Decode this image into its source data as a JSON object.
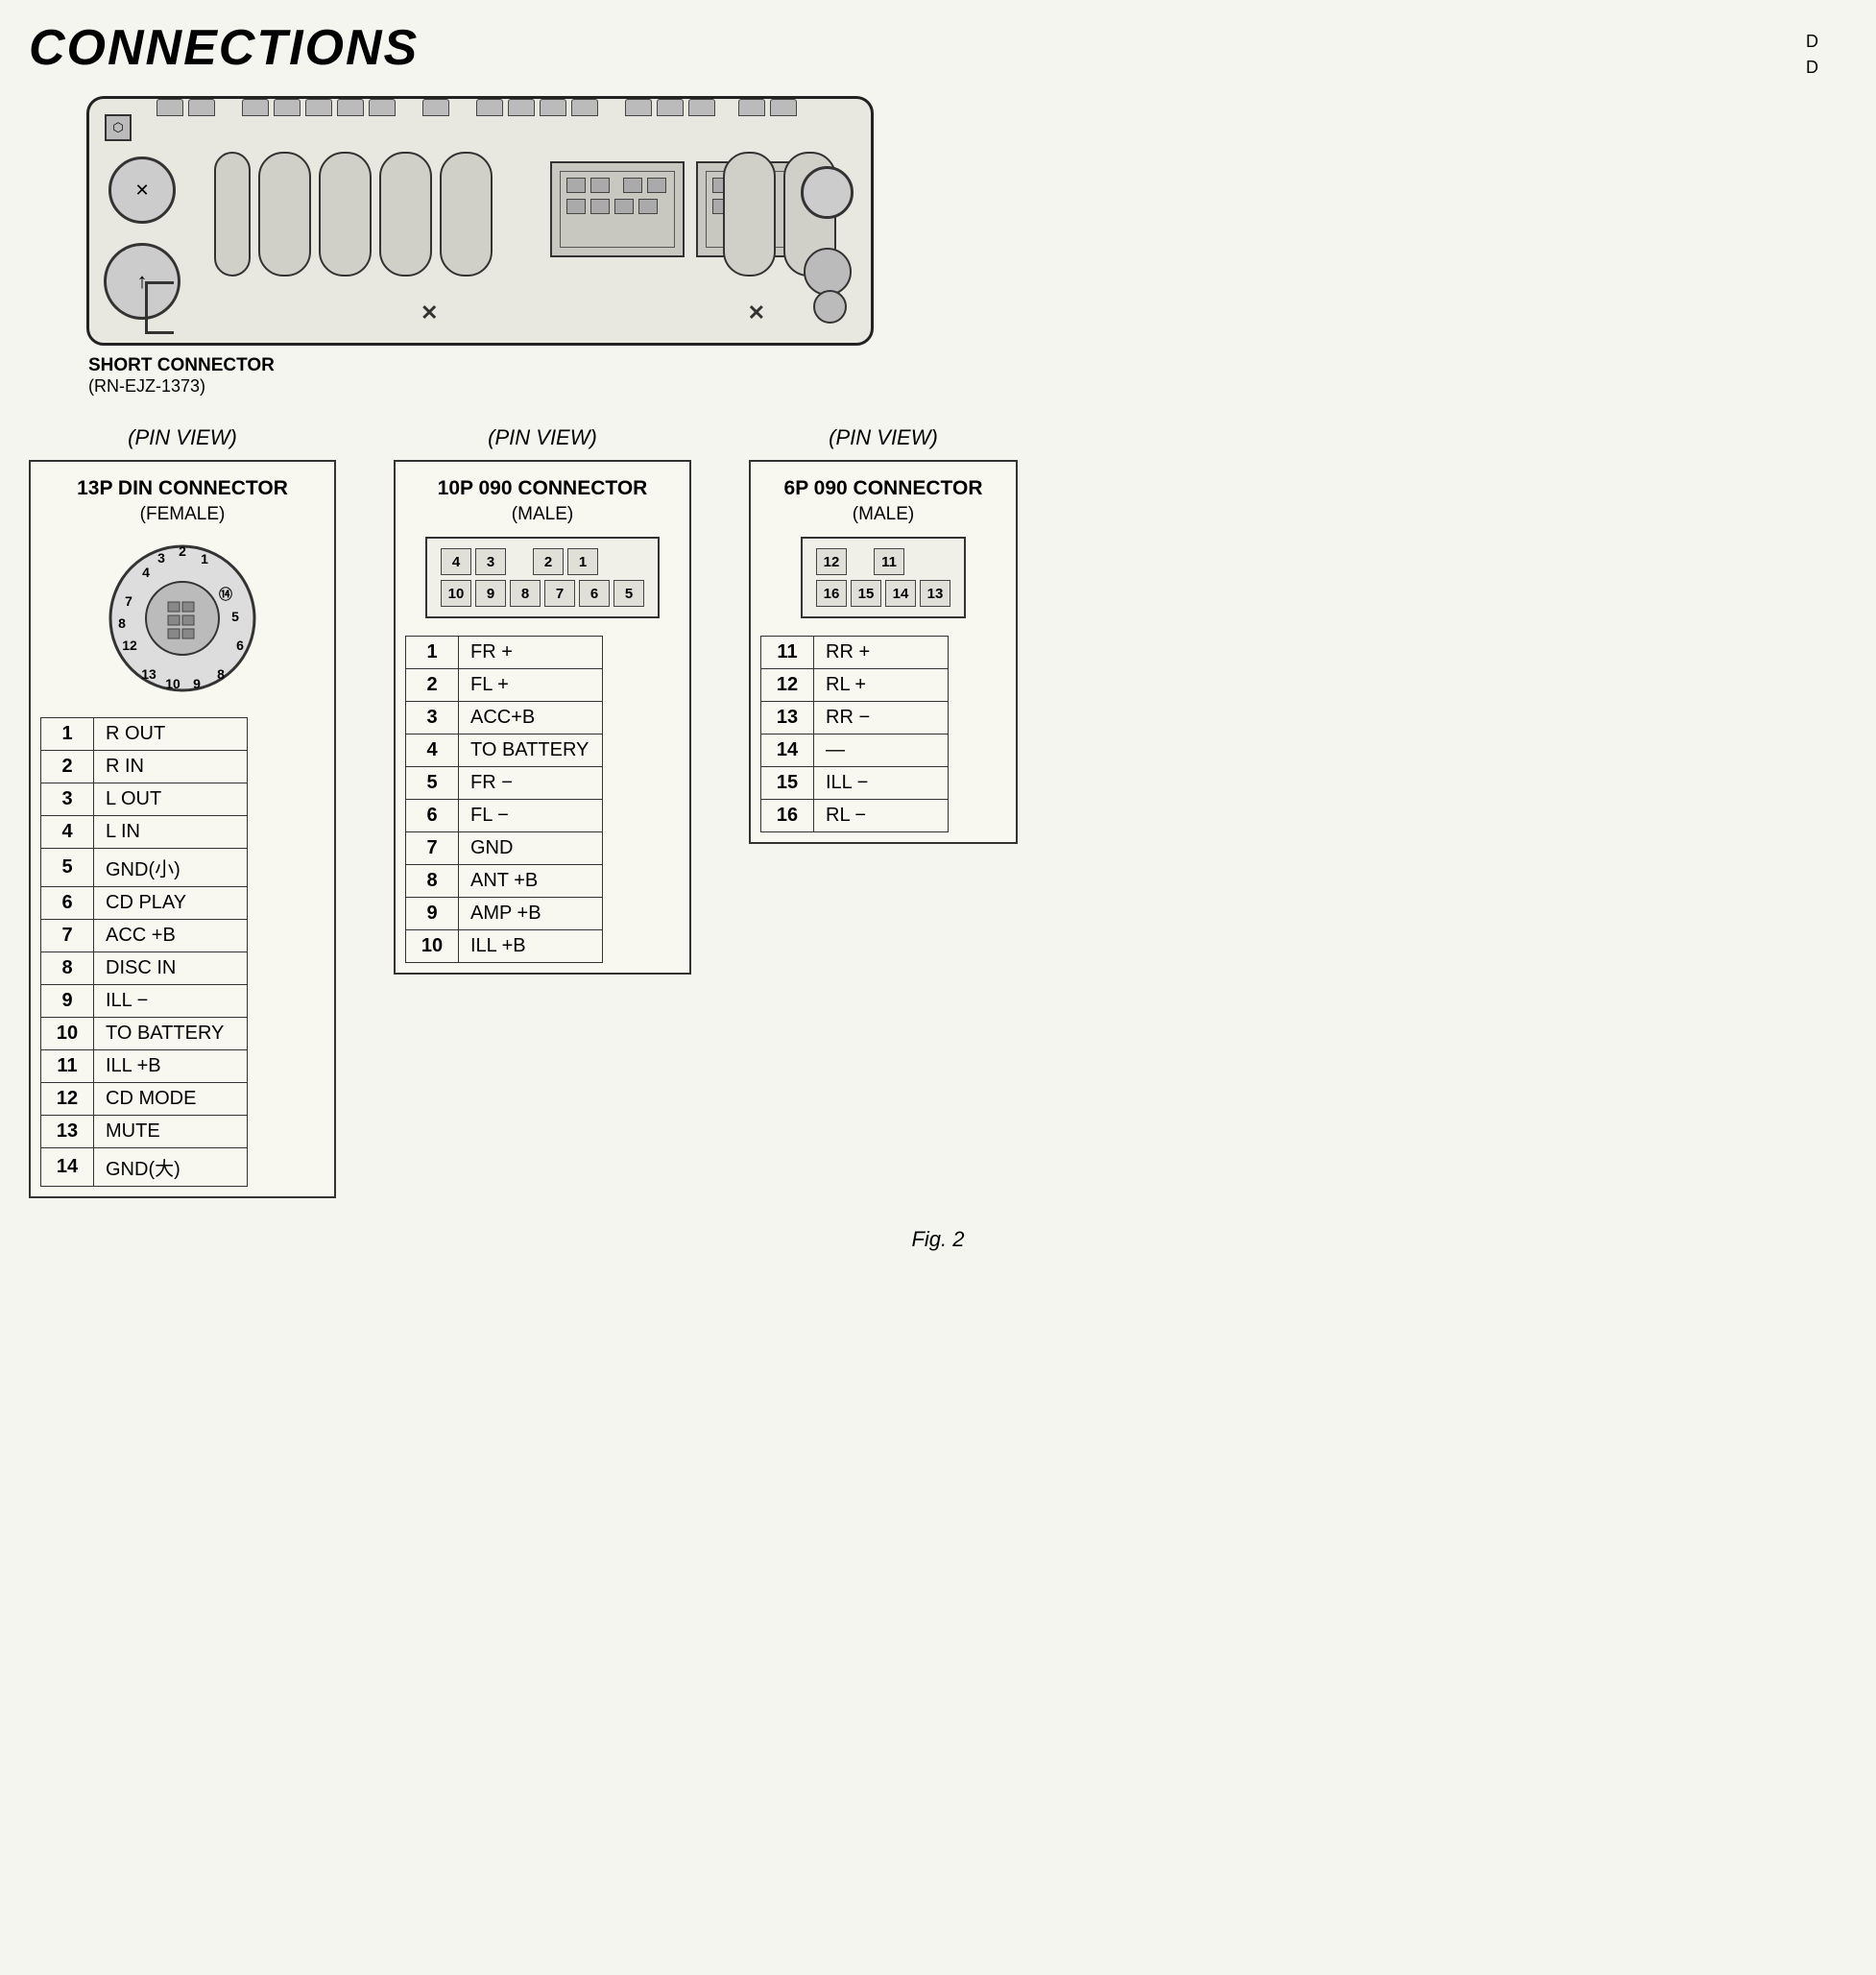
{
  "page": {
    "title": "CONNECTIONS",
    "corner_note": "D\nD",
    "short_connector_label": "SHORT CONNECTOR",
    "short_connector_code": "(RN-EJZ-1373)",
    "fig_label": "Fig. 2"
  },
  "pin_view_13p": {
    "view_label": "(PIN  VIEW)",
    "connector_title": "13P DIN CONNECTOR",
    "connector_subtitle": "(FEMALE)",
    "pins": [
      {
        "num": "1",
        "name": "R OUT"
      },
      {
        "num": "2",
        "name": "R IN"
      },
      {
        "num": "3",
        "name": "L OUT"
      },
      {
        "num": "4",
        "name": "L IN"
      },
      {
        "num": "5",
        "name": "GND(小)"
      },
      {
        "num": "6",
        "name": "CD PLAY"
      },
      {
        "num": "7",
        "name": "ACC +B"
      },
      {
        "num": "8",
        "name": "DISC IN"
      },
      {
        "num": "9",
        "name": "ILL −"
      },
      {
        "num": "10",
        "name": "TO BATTERY"
      },
      {
        "num": "11",
        "name": "ILL +B"
      },
      {
        "num": "12",
        "name": "CD MODE"
      },
      {
        "num": "13",
        "name": "MUTE"
      },
      {
        "num": "14",
        "name": "GND(大)"
      }
    ]
  },
  "pin_view_10p": {
    "view_label": "(PIN  VIEW)",
    "connector_title": "10P 090 CONNECTOR",
    "connector_subtitle": "(MALE)",
    "diagram_row1": [
      "4",
      "3",
      "",
      "2",
      "1"
    ],
    "diagram_row2": [
      "10",
      "9",
      "8",
      "7",
      "6",
      "5"
    ],
    "pins": [
      {
        "num": "1",
        "name": "FR +"
      },
      {
        "num": "2",
        "name": "FL +"
      },
      {
        "num": "3",
        "name": "ACC+B"
      },
      {
        "num": "4",
        "name": "TO BATTERY"
      },
      {
        "num": "5",
        "name": "FR −"
      },
      {
        "num": "6",
        "name": "FL −"
      },
      {
        "num": "7",
        "name": "GND"
      },
      {
        "num": "8",
        "name": "ANT +B"
      },
      {
        "num": "9",
        "name": "AMP +B"
      },
      {
        "num": "10",
        "name": "ILL +B"
      }
    ]
  },
  "pin_view_6p": {
    "view_label": "(PIN  VIEW)",
    "connector_title": "6P 090 CONNECTOR",
    "connector_subtitle": "(MALE)",
    "diagram_row1": [
      "12",
      "",
      "11"
    ],
    "diagram_row2": [
      "16",
      "15",
      "14",
      "13"
    ],
    "pins": [
      {
        "num": "11",
        "name": "RR +"
      },
      {
        "num": "12",
        "name": "RL +"
      },
      {
        "num": "13",
        "name": "RR −"
      },
      {
        "num": "14",
        "name": "—"
      },
      {
        "num": "15",
        "name": "ILL −"
      },
      {
        "num": "16",
        "name": "RL −"
      }
    ]
  }
}
